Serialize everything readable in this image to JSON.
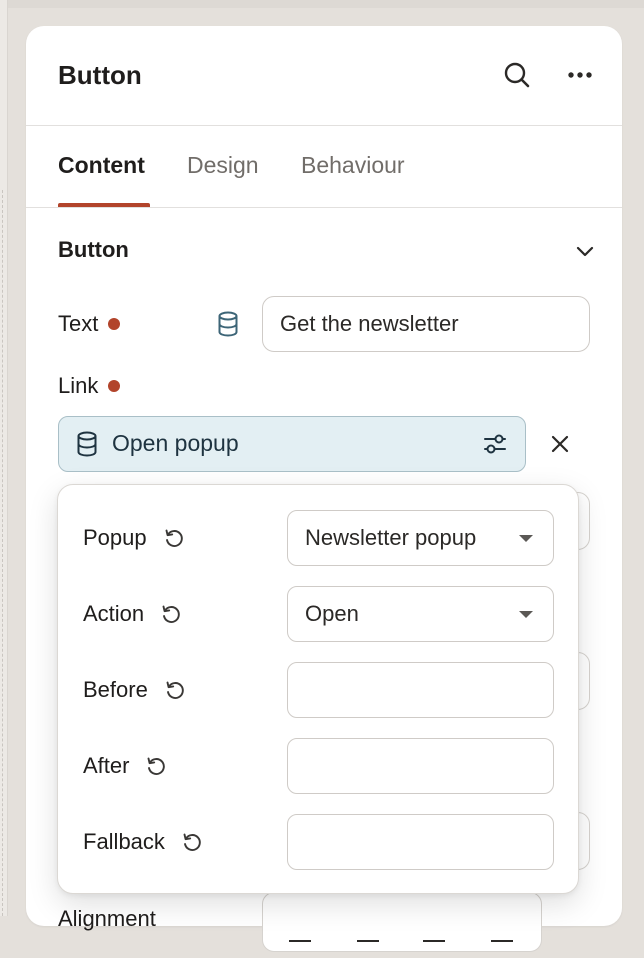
{
  "panel": {
    "title": "Button",
    "icons": {
      "search": "search-icon",
      "more": "more-horizontal-icon"
    }
  },
  "tabs": [
    {
      "label": "Content",
      "active": true
    },
    {
      "label": "Design",
      "active": false
    },
    {
      "label": "Behaviour",
      "active": false
    }
  ],
  "section": {
    "title": "Button",
    "toggle_icon": "chevron-down-icon"
  },
  "fields": {
    "text_label": "Text",
    "text_value": "Get the newsletter",
    "text_source_icon": "database-icon",
    "link_label": "Link",
    "link_value": "Open popup",
    "link_source_icon": "database-icon",
    "link_settings_icon": "sliders-icon",
    "link_clear_icon": "close-icon"
  },
  "popover": {
    "rows": [
      {
        "label": "Popup",
        "value": "Newsletter popup",
        "type": "select"
      },
      {
        "label": "Action",
        "value": "Open",
        "type": "select"
      },
      {
        "label": "Before",
        "value": "",
        "type": "text"
      },
      {
        "label": "After",
        "value": "",
        "type": "text"
      },
      {
        "label": "Fallback",
        "value": "",
        "type": "text"
      }
    ],
    "reset_icon": "reset-icon"
  },
  "behind": {
    "partial_label": "Alignment"
  },
  "colors": {
    "accent": "#b2442b",
    "chip_bg": "#e3eff3",
    "chip_border": "#a9bfc7",
    "panel_bg": "#ffffff",
    "page_bg": "#e4e0db"
  }
}
